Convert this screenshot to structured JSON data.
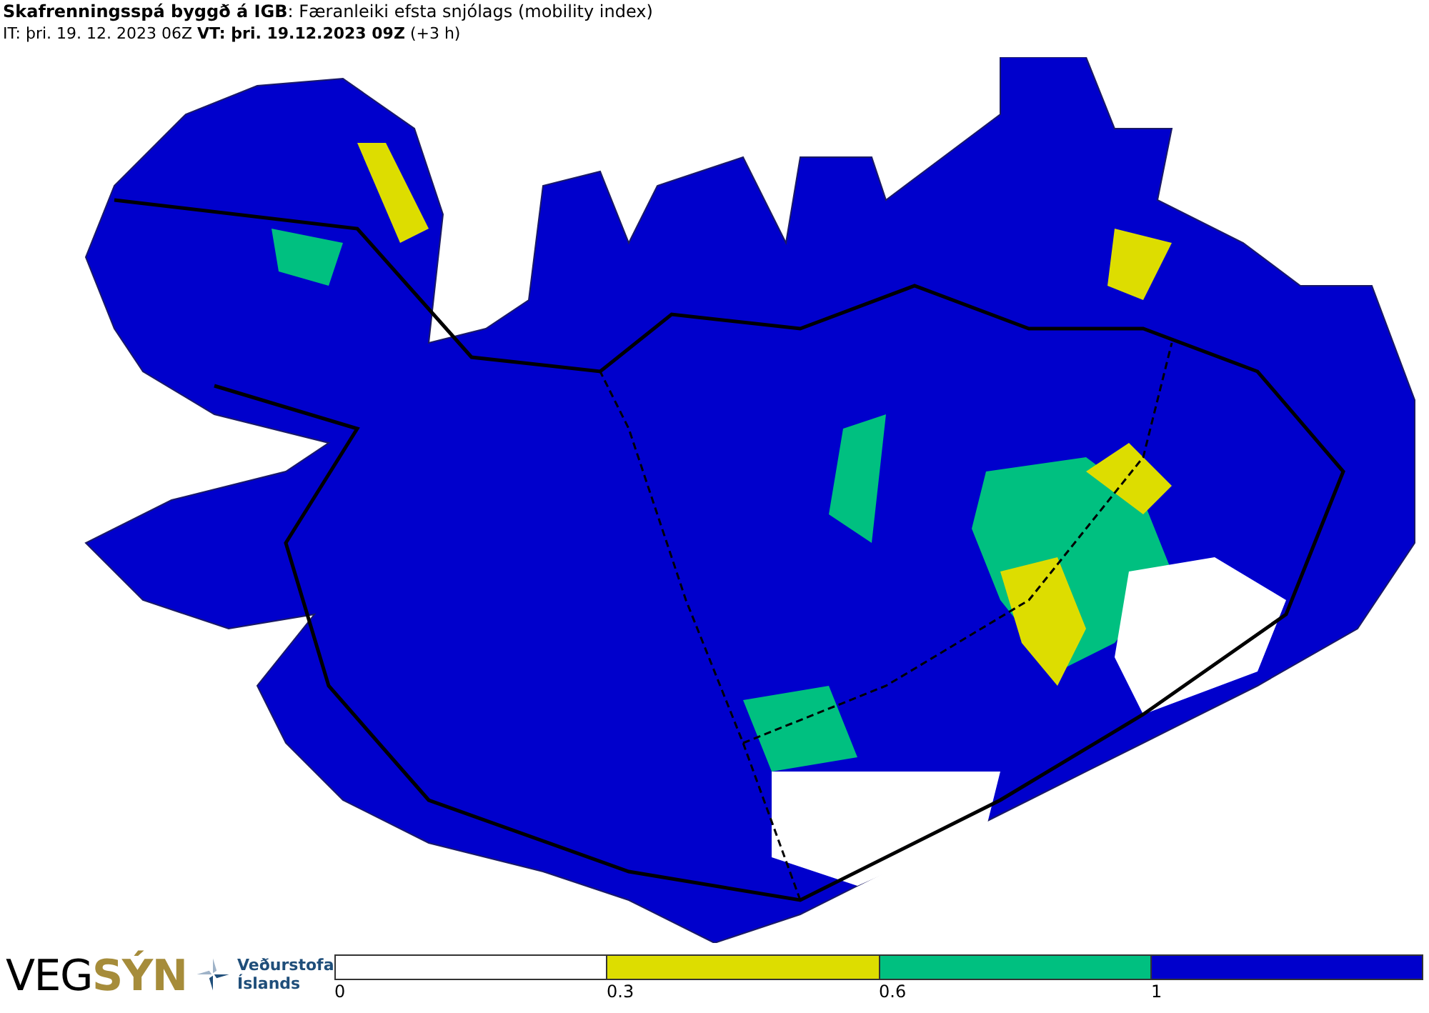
{
  "header": {
    "title": "**Skafrenningsspá byggð á IGB**: Færanleiki efsta snjólags (mobility index)",
    "times": "IT: þri. 19. 12. 2023 06Z **VT: þri. 19.12.2023 09Z** (+3 h)"
  },
  "logos": {
    "vegsyn": [
      "VEG",
      "SÝN"
    ],
    "vedurstofa": [
      "Veðurstofa",
      "Íslands"
    ]
  },
  "legend": {
    "bins": [
      {
        "label": "0",
        "color": "#ffffff"
      },
      {
        "label": "0.3",
        "color": "#dddd00"
      },
      {
        "label": "0.6",
        "color": "#00c080"
      },
      {
        "label": "1",
        "color": "#0000cc"
      }
    ]
  }
}
